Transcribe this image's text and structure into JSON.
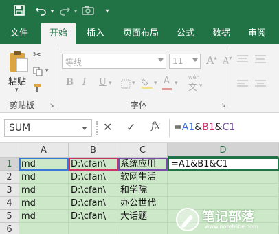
{
  "qat": {
    "icons": [
      "save-icon",
      "undo-icon",
      "redo-icon",
      "camera-icon",
      "customize-qat-icon"
    ]
  },
  "tabs": [
    {
      "label": "文件"
    },
    {
      "label": "开始",
      "active": true
    },
    {
      "label": "插入"
    },
    {
      "label": "页面布局"
    },
    {
      "label": "公式"
    },
    {
      "label": "数据"
    },
    {
      "label": "审阅"
    }
  ],
  "ribbon": {
    "paste_label": "粘贴",
    "clipboard_group": "剪贴板",
    "font_name": "等线",
    "font_size": "11",
    "font_group": "字体",
    "wen_label": "wén"
  },
  "formula_bar": {
    "name_box": "SUM",
    "fx_label": "fx",
    "formula": "=A1&B1&C1"
  },
  "grid": {
    "columns": [
      "A",
      "B",
      "C",
      "D"
    ],
    "rows": [
      {
        "num": "1",
        "A": "md",
        "B": "D:\\cfan\\",
        "C": "系统应用",
        "D": "=A1&B1&C1"
      },
      {
        "num": "2",
        "A": "md",
        "B": "D:\\cfan\\",
        "C": "软网生活",
        "D": ""
      },
      {
        "num": "3",
        "A": "md",
        "B": "D:\\cfan\\",
        "C": "和学院",
        "D": ""
      },
      {
        "num": "4",
        "A": "md",
        "B": "D:\\cfan\\",
        "C": "办公世代",
        "D": ""
      },
      {
        "num": "5",
        "A": "md",
        "B": "D:\\cfan\\",
        "C": "大话题",
        "D": ""
      },
      {
        "num": "6",
        "A": "",
        "B": "",
        "C": "",
        "D": ""
      }
    ]
  },
  "watermark": {
    "brand": "笔记部落",
    "url": "www.notetribe.com"
  },
  "colors": {
    "excel_green": "#217346",
    "ref_a": "#3c78d8",
    "ref_b": "#cc3366",
    "ref_c": "#7a4ca8"
  }
}
